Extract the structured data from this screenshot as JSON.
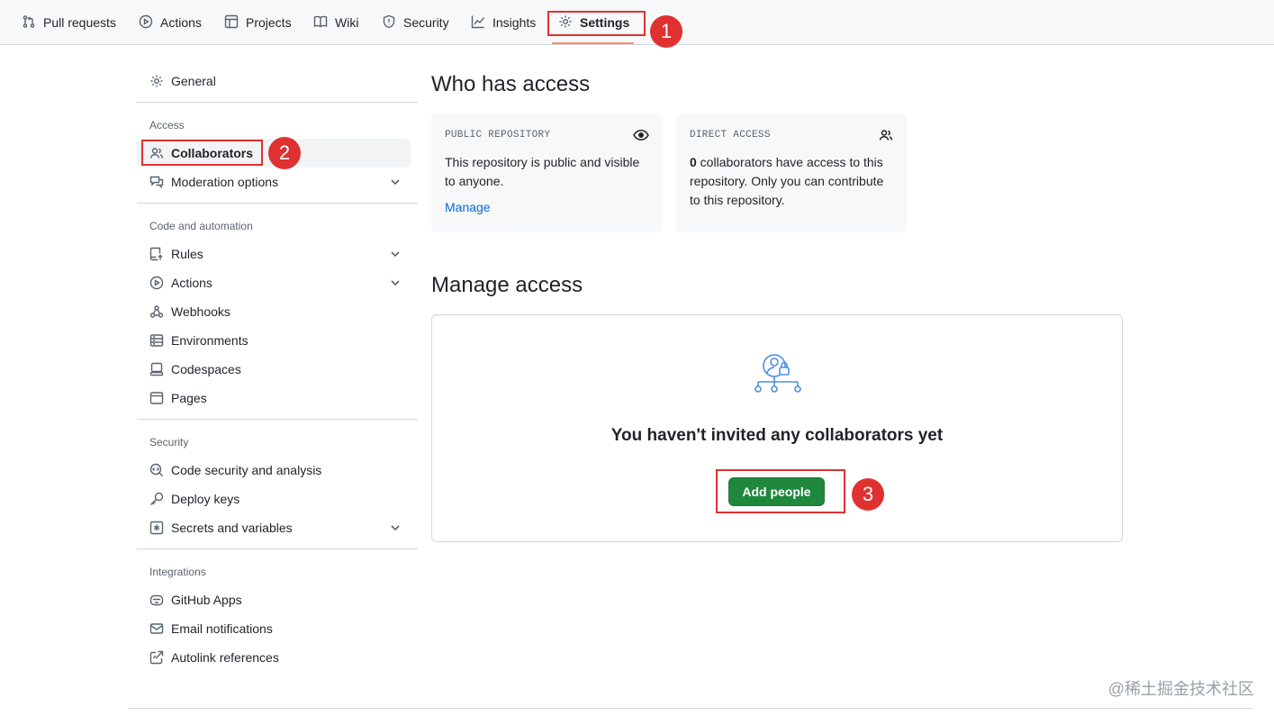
{
  "repo_nav": {
    "tabs": [
      {
        "label": "Pull requests",
        "icon": "git-pull-request-icon"
      },
      {
        "label": "Actions",
        "icon": "play-icon"
      },
      {
        "label": "Projects",
        "icon": "table-icon"
      },
      {
        "label": "Wiki",
        "icon": "book-icon"
      },
      {
        "label": "Security",
        "icon": "shield-icon"
      },
      {
        "label": "Insights",
        "icon": "graph-icon"
      },
      {
        "label": "Settings",
        "icon": "gear-icon",
        "active": true
      }
    ]
  },
  "sidebar": {
    "general": "General",
    "sections": {
      "access": "Access",
      "code_automation": "Code and automation",
      "security": "Security",
      "integrations": "Integrations"
    },
    "items": {
      "collaborators": "Collaborators",
      "moderation": "Moderation options",
      "rules": "Rules",
      "actions": "Actions",
      "webhooks": "Webhooks",
      "environments": "Environments",
      "codespaces": "Codespaces",
      "pages": "Pages",
      "code_security": "Code security and analysis",
      "deploy_keys": "Deploy keys",
      "secrets": "Secrets and variables",
      "github_apps": "GitHub Apps",
      "email_notifications": "Email notifications",
      "autolink": "Autolink references"
    }
  },
  "who_has_access": {
    "title": "Who has access",
    "public_card": {
      "title": "PUBLIC REPOSITORY",
      "text": "This repository is public and visible to anyone.",
      "link": "Manage",
      "icon": "eye-icon"
    },
    "direct_card": {
      "title": "DIRECT ACCESS",
      "count": "0",
      "text": " collaborators have access to this repository. Only you can contribute to this repository.",
      "icon": "people-icon"
    }
  },
  "manage_access": {
    "title": "Manage access",
    "empty_title": "You haven't invited any collaborators yet",
    "add_button": "Add people",
    "illustration": "collaborators-lock-icon"
  },
  "annotations": {
    "step1": "1",
    "step2": "2",
    "step3": "3",
    "color": "#e03131"
  },
  "watermark": "@稀土掘金技术社区",
  "colors": {
    "link": "#0969da",
    "primary_button": "#1f883d",
    "selected_bar": "#0969da",
    "tab_underline": "#fd8c73"
  }
}
